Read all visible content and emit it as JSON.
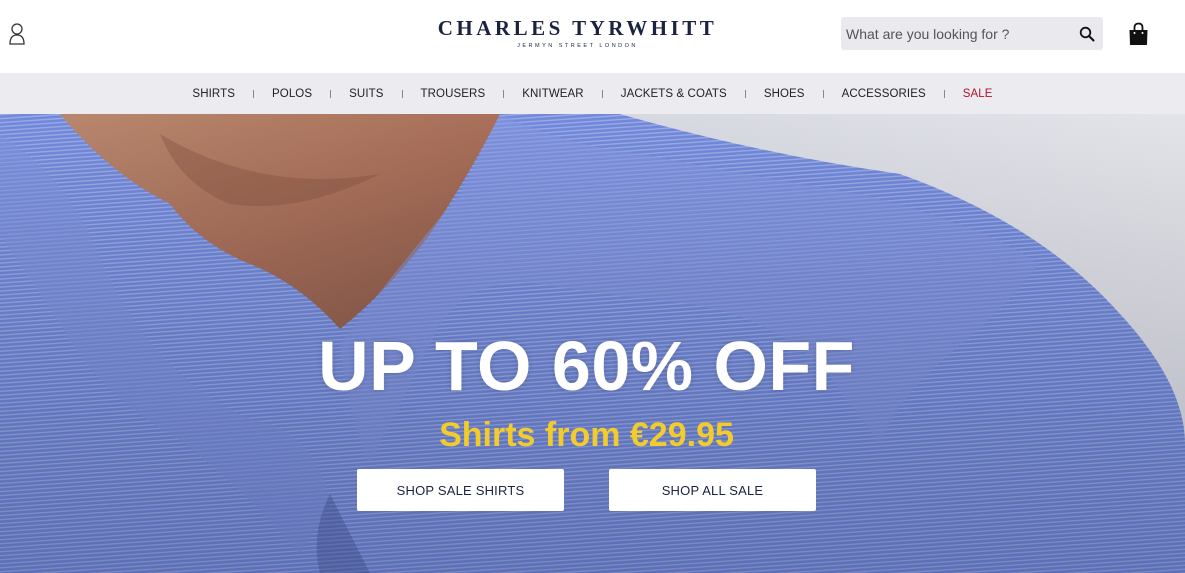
{
  "header": {
    "account_icon": "account-icon",
    "logo": {
      "name": "CHARLES TYRWHITT",
      "tagline": "JERMYN STREET LONDON"
    },
    "search": {
      "placeholder": "What are you looking for ?",
      "value": "",
      "icon": "search-icon"
    },
    "bag_icon": "shopping-bag-icon"
  },
  "nav": {
    "items": [
      {
        "label": "SHIRTS"
      },
      {
        "label": "POLOS"
      },
      {
        "label": "SUITS"
      },
      {
        "label": "TROUSERS"
      },
      {
        "label": "KNITWEAR"
      },
      {
        "label": "JACKETS & COATS"
      },
      {
        "label": "SHOES"
      },
      {
        "label": "ACCESSORIES"
      },
      {
        "label": "SALE",
        "color": "#b2122e"
      }
    ]
  },
  "hero": {
    "title": "UP TO 60% OFF",
    "subtitle": "Shirts from €29.95",
    "subtitle_color": "#f2cc2c",
    "buttons": [
      {
        "label": "SHOP SALE SHIRTS"
      },
      {
        "label": "SHOP ALL SALE"
      }
    ]
  },
  "colors": {
    "brand_navy": "#1b2340",
    "shirt_blue": "#6f86d6",
    "nav_bg": "#ebebf0"
  }
}
